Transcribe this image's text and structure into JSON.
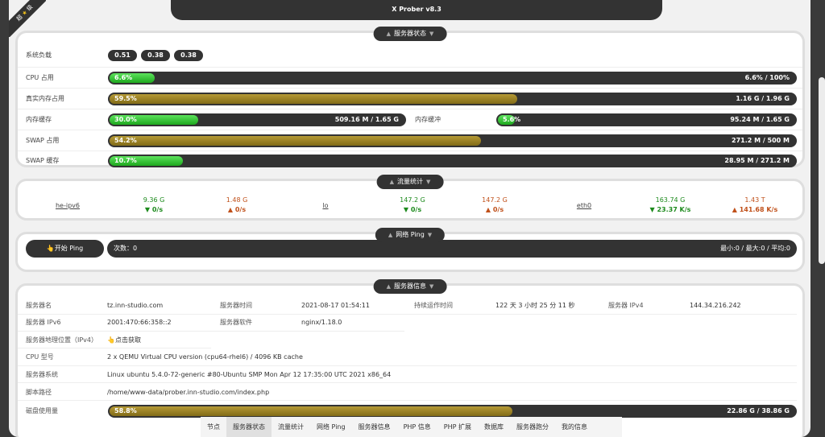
{
  "app": {
    "title": "X Prober v8.3",
    "ribbon_left": "超",
    "ribbon_right": "级"
  },
  "sections": {
    "status": "服务器状态",
    "network": "流量统计",
    "ping": "网络 Ping",
    "info": "服务器信息"
  },
  "status": {
    "load_label": "系统负载",
    "loads": [
      "0.51",
      "0.38",
      "0.38"
    ],
    "cpu": {
      "label": "CPU 占用",
      "percent": "6.6%",
      "value": "6.6% / 100%",
      "fraction": 0.066
    },
    "real_mem": {
      "label": "真实内存占用",
      "percent": "59.5%",
      "value": "1.16 G / 1.96 G",
      "fraction": 0.595
    },
    "mem_cache": {
      "label": "内存缓存",
      "percent": "30.0%",
      "value": "509.16 M / 1.65 G",
      "fraction": 0.3
    },
    "mem_buffer": {
      "label": "内存缓冲",
      "percent": "5.6%",
      "value": "95.24 M / 1.65 G",
      "fraction": 0.056
    },
    "swap": {
      "label": "SWAP 占用",
      "percent": "54.2%",
      "value": "271.2 M / 500 M",
      "fraction": 0.542
    },
    "swap_cache": {
      "label": "SWAP 缓存",
      "percent": "10.7%",
      "value": "28.95 M / 271.2 M",
      "fraction": 0.107
    }
  },
  "network": [
    {
      "name": "he-ipv6",
      "in_total": "9.36 G",
      "out_total": "1.48 G",
      "in_speed": "▼ 0/s",
      "out_speed": "▲ 0/s"
    },
    {
      "name": "lo",
      "in_total": "147.2 G",
      "out_total": "147.2 G",
      "in_speed": "▼ 0/s",
      "out_speed": "▲ 0/s"
    },
    {
      "name": "eth0",
      "in_total": "163.74 G",
      "out_total": "1.43 T",
      "in_speed": "▼ 23.37 K/s",
      "out_speed": "▲ 141.68 K/s"
    }
  ],
  "ping": {
    "button": "👆开始 Ping",
    "count": "次数：0",
    "stats": "最小:0 / 最大:0 / 平均:0"
  },
  "info": {
    "server_name_k": "服务器名",
    "server_name_v": "tz.inn-studio.com",
    "server_time_k": "服务器时间",
    "server_time_v": "2021-08-17 01:54:11",
    "uptime_k": "持续运作时间",
    "uptime_v": "122 天 3 小时 25 分 11 秒",
    "ipv4_k": "服务器 IPv4",
    "ipv4_v": "144.34.216.242",
    "ipv6_k": "服务器 IPv6",
    "ipv6_v": "2001:470:66:358::2",
    "software_k": "服务器软件",
    "software_v": "nginx/1.18.0",
    "geo_k": "服务器地理位置（IPv4）",
    "geo_v": "👆点击获取",
    "cpu_k": "CPU 型号",
    "cpu_v": "2 x QEMU Virtual CPU version (cpu64-rhel6) / 4096 KB cache",
    "os_k": "服务器系统",
    "os_v": "Linux ubuntu 5.4.0-72-generic #80-Ubuntu SMP Mon Apr 12 17:35:00 UTC 2021 x86_64",
    "path_k": "脚本路径",
    "path_v": "/home/www-data/prober.inn-studio.com/index.php",
    "disk_k": "磁盘使用量",
    "disk_percent": "58.8%",
    "disk_value": "22.86 G / 38.86 G",
    "disk_fraction": 0.588
  },
  "nav": [
    "节点",
    "服务器状态",
    "流量统计",
    "网络 Ping",
    "服务器信息",
    "PHP 信息",
    "PHP 扩展",
    "数据库",
    "服务器跑分",
    "我的信息"
  ],
  "nav_active": 1,
  "colors": {
    "bar_bg": "#333333",
    "fill_green": "#2fbf2f",
    "fill_gold": "#9c8226",
    "net_in": "#1c8a1c",
    "net_out": "#c0501a"
  }
}
